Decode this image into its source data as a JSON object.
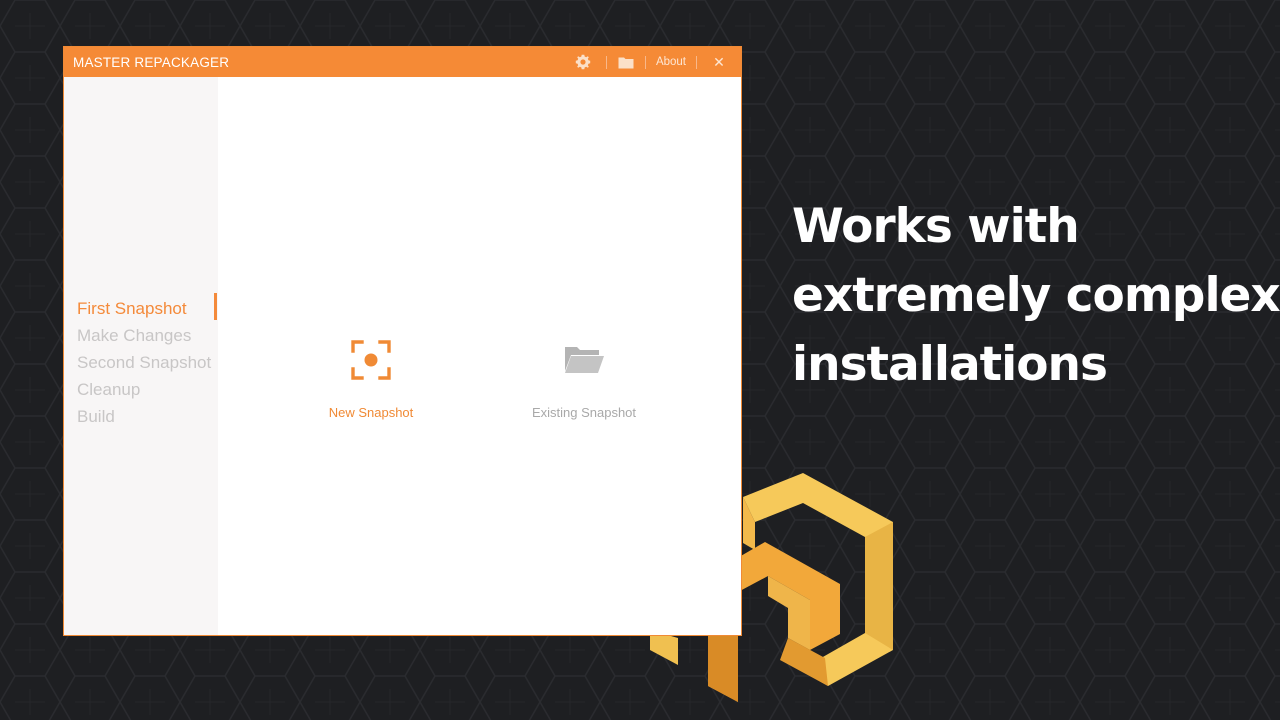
{
  "window": {
    "title": "MASTER REPACKAGER",
    "titlebar_buttons": {
      "settings_icon": "gear-icon",
      "folder_icon": "folder-icon",
      "about_label": "About",
      "close_label": "✕"
    }
  },
  "sidebar": {
    "steps": [
      {
        "label": "First Snapshot",
        "active": true
      },
      {
        "label": "Make Changes",
        "active": false
      },
      {
        "label": "Second Snapshot",
        "active": false
      },
      {
        "label": "Cleanup",
        "active": false
      },
      {
        "label": "Build",
        "active": false
      }
    ]
  },
  "main": {
    "options": [
      {
        "label": "New Snapshot",
        "icon": "snapshot-target-icon"
      },
      {
        "label": "Existing Snapshot",
        "icon": "open-folder-icon"
      }
    ]
  },
  "promo": {
    "lines": [
      "Works with",
      "extremely complex",
      "installations"
    ]
  },
  "colors": {
    "accent": "#f58a36",
    "background": "#1e1f22",
    "inactive_text": "#c8c6c6",
    "logo_light": "#f6c95a",
    "logo_dark": "#e59a30"
  }
}
